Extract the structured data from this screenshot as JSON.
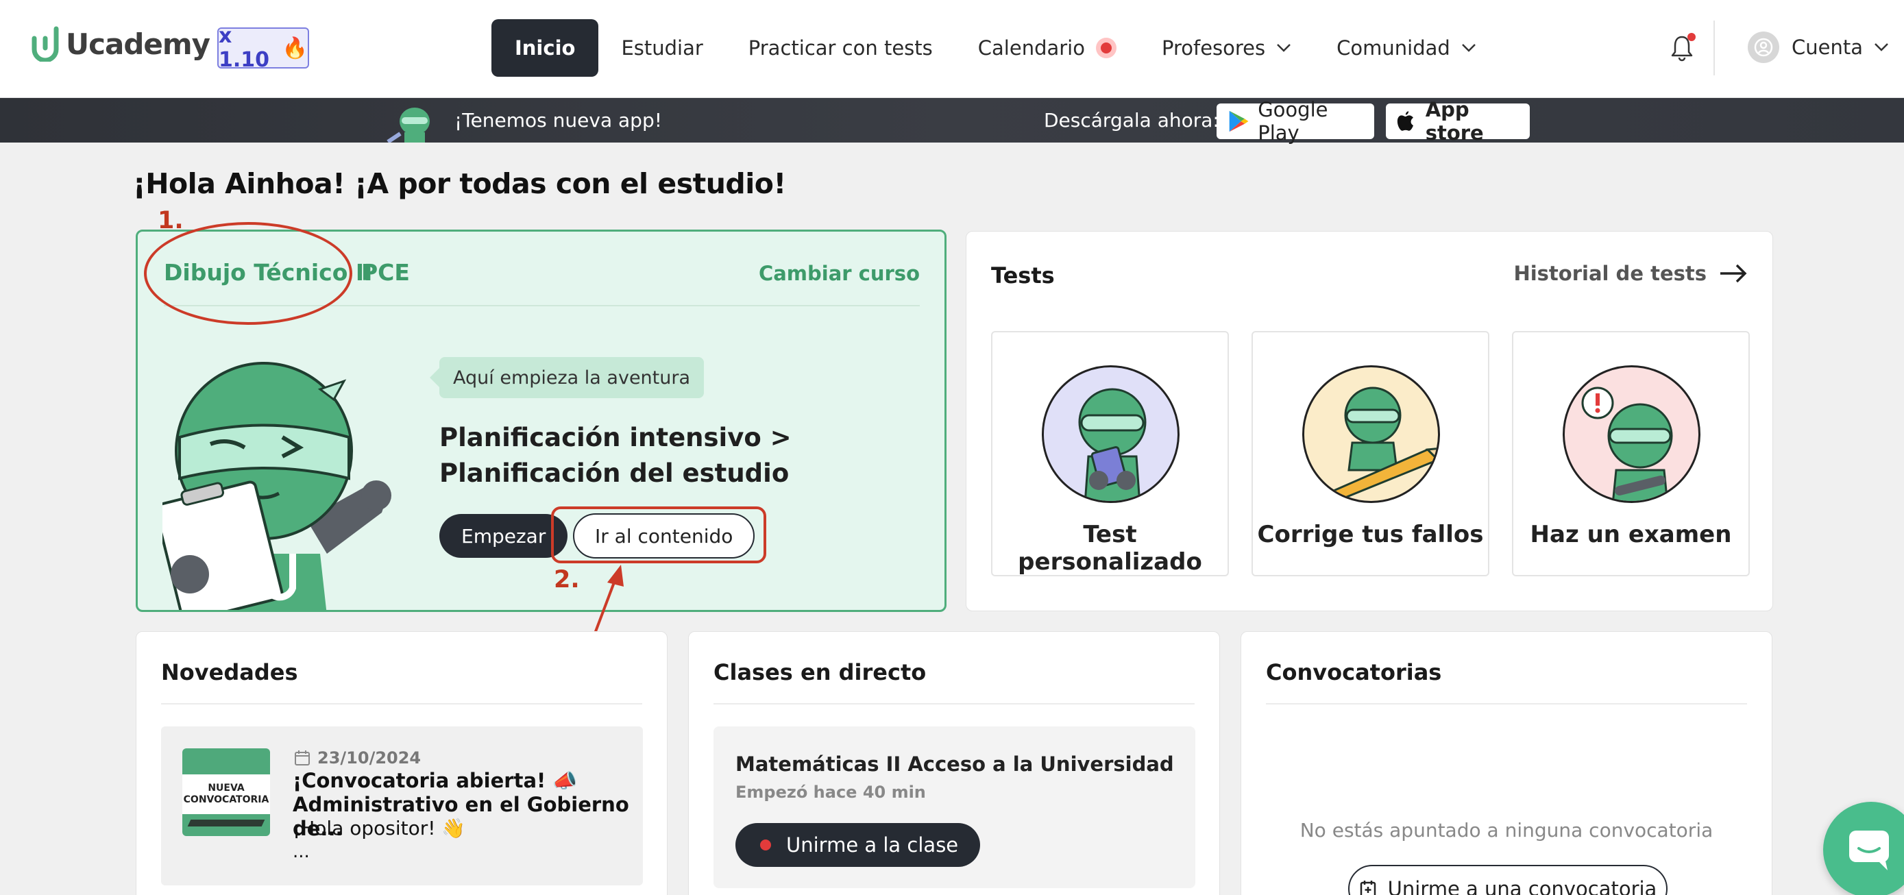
{
  "header": {
    "logo_text": "Ucademy",
    "version_badge": "x 1.10",
    "nav": [
      {
        "label": "Inicio",
        "active": true
      },
      {
        "label": "Estudiar"
      },
      {
        "label": "Practicar con tests"
      },
      {
        "label": "Calendario"
      },
      {
        "label": "Profesores"
      },
      {
        "label": "Comunidad"
      }
    ],
    "account_label": "Cuenta"
  },
  "promo": {
    "text": "¡Tenemos nueva app!",
    "download_label": "Descárgala ahora:",
    "google_play": "Google Play",
    "app_store": "App store"
  },
  "greeting": "¡Hola Ainhoa! ¡A por todas con el estudio!",
  "course": {
    "name": "Dibujo Técnico II",
    "code": "PCE",
    "change_label": "Cambiar curso",
    "bubble": "Aquí empieza la aventura",
    "lesson_title": "Planificación intensivo > Planificación del estudio",
    "start_label": "Empezar",
    "go_label": "Ir al contenido"
  },
  "annotations": {
    "step1": "1.",
    "step2": "2."
  },
  "tests": {
    "title": "Tests",
    "history_label": "Historial de tests",
    "tiles": [
      {
        "label": "Test personalizado",
        "bg": "#e0e0f8"
      },
      {
        "label": "Corrige tus fallos",
        "bg": "#fbecc9"
      },
      {
        "label": "Haz un examen",
        "bg": "#fbe0e0"
      }
    ]
  },
  "news": {
    "title": "Novedades",
    "thumb_line1": "NUEVA",
    "thumb_line2": "CONVOCATORIA",
    "date": "23/10/2024",
    "item_title": "¡Convocatoria abierta! 📣 Administrativo en el Gobierno de...",
    "item_sub": "¡Hola opositor! 👋",
    "item_more": "..."
  },
  "live_classes": {
    "title": "Clases en directo",
    "class_title": "Matemáticas II Acceso a la Universidad",
    "class_time": "Empezó hace 40 min",
    "join_label": "Unirme a la clase"
  },
  "calls": {
    "title": "Convocatorias",
    "empty_msg": "No estás apuntado a ninguna convocatoria",
    "join_label": "Unirme a una convocatoria"
  },
  "colors": {
    "brand_green": "#4fae7c",
    "dark": "#262b33",
    "annotation_red": "#cc3b28"
  }
}
